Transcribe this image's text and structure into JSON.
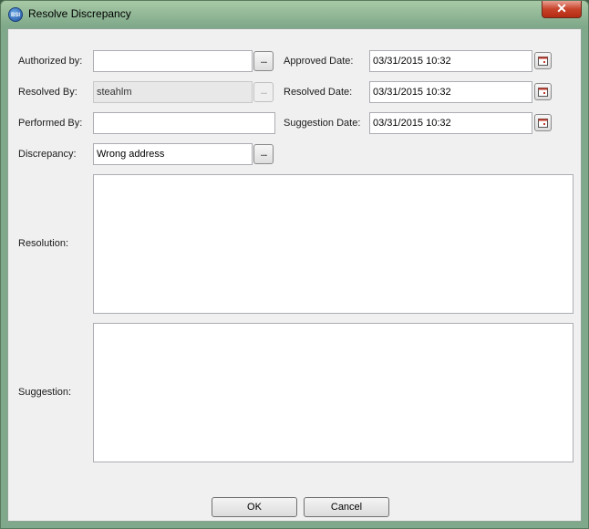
{
  "window": {
    "title": "Resolve Discrepancy",
    "app_icon_text": "BSI",
    "close_glyph": "✕"
  },
  "form": {
    "authorized_by": {
      "label": "Authorized by:",
      "value": ""
    },
    "resolved_by": {
      "label": "Resolved By:",
      "value": "steahlm"
    },
    "performed_by": {
      "label": "Performed By:",
      "value": ""
    },
    "discrepancy": {
      "label": "Discrepancy:",
      "value": "Wrong address"
    },
    "approved_date": {
      "label": "Approved Date:",
      "value": "03/31/2015 10:32"
    },
    "resolved_date": {
      "label": "Resolved Date:",
      "value": "03/31/2015 10:32"
    },
    "suggestion_date": {
      "label": "Suggestion Date:",
      "value": "03/31/2015 10:32"
    },
    "resolution": {
      "label": "Resolution:",
      "value": ""
    },
    "suggestion": {
      "label": "Suggestion:",
      "value": ""
    },
    "browse_glyph": "...",
    "calendar_icon": "calendar-icon"
  },
  "buttons": {
    "ok": "OK",
    "cancel": "Cancel"
  }
}
